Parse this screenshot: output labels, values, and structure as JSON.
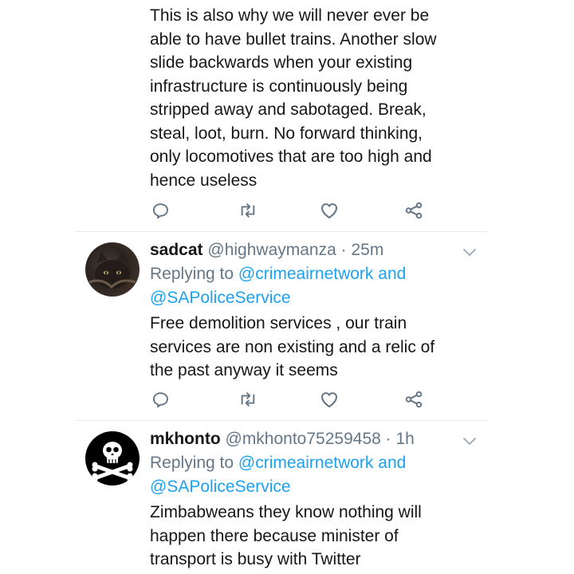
{
  "tweets": [
    {
      "body_lines": [
        "This is also why we will never ever be",
        "able to have bullet trains. Another slow",
        "slide backwards when your existing",
        "infrastructure is continuously being",
        "stripped away and sabotaged. Break,",
        "steal, loot, burn. No forward thinking,",
        "only locomotives that are too high and",
        "hence useless"
      ]
    },
    {
      "name": "sadcat",
      "handle": "@highwaymanza",
      "separator": "·",
      "time": "25m",
      "replying_prefix": "Replying to",
      "reply_mention_1": "@crimeairnetwork",
      "reply_and": "and",
      "reply_mention_2": "@SAPoliceService",
      "body_lines": [
        "Free demolition services  , our train",
        "services are non existing and a relic of",
        "the past anyway it seems"
      ]
    },
    {
      "name": "mkhonto",
      "handle": "@mkhonto75259458",
      "separator": "·",
      "time": "1h",
      "replying_prefix": "Replying to",
      "reply_mention_1": "@crimeairnetwork",
      "reply_and": "and",
      "reply_mention_2": "@SAPoliceService",
      "body_lines": [
        "Zimbabweans they know nothing will",
        "happen there because minister of",
        "transport is busy with Twitter"
      ]
    }
  ],
  "icons": {
    "reply": "reply-icon",
    "retweet": "retweet-icon",
    "like": "heart-icon",
    "share": "share-icon",
    "menu": "chevron-down-icon"
  },
  "colors": {
    "text": "#14171a",
    "secondary": "#657786",
    "link": "#1da1f2",
    "divider": "#e6ecf0"
  }
}
